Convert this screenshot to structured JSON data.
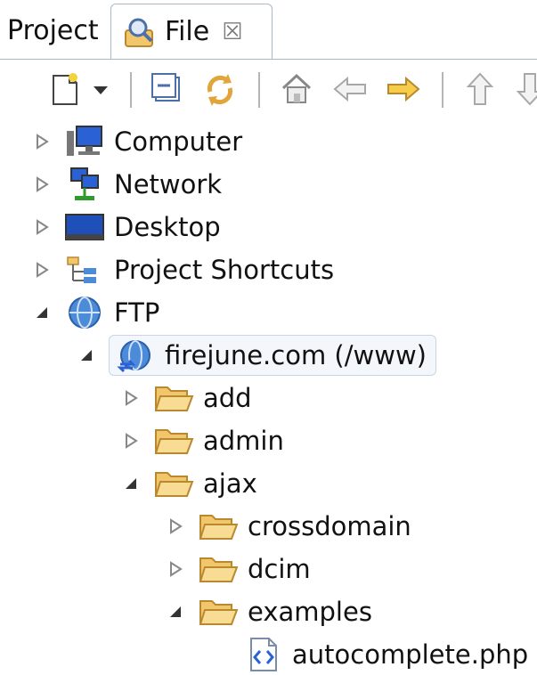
{
  "tabs": [
    {
      "label": "Project"
    },
    {
      "label": "File",
      "close_glyph": "☒"
    }
  ],
  "toolbar": {
    "icons": [
      "new-file-icon",
      "dropdown-arrow-icon",
      "collapse-all-icon",
      "refresh-icon",
      "home-icon",
      "back-arrow-icon",
      "forward-arrow-icon",
      "up-arrow-icon",
      "down-arrow-icon"
    ]
  },
  "tree": {
    "items": [
      {
        "label": "Computer",
        "icon": "computer-icon",
        "expanded": false
      },
      {
        "label": "Network",
        "icon": "network-icon",
        "expanded": false
      },
      {
        "label": "Desktop",
        "icon": "desktop-icon",
        "expanded": false
      },
      {
        "label": "Project Shortcuts",
        "icon": "shortcuts-icon",
        "expanded": false
      },
      {
        "label": "FTP",
        "icon": "globe-icon",
        "expanded": true
      },
      {
        "label": "firejune.com (/www)",
        "icon": "ftp-site-icon",
        "expanded": true,
        "selected": true
      },
      {
        "label": "add",
        "icon": "folder-icon",
        "expanded": false
      },
      {
        "label": "admin",
        "icon": "folder-icon",
        "expanded": false
      },
      {
        "label": "ajax",
        "icon": "folder-icon",
        "expanded": true
      },
      {
        "label": "crossdomain",
        "icon": "folder-icon",
        "expanded": false
      },
      {
        "label": "dcim",
        "icon": "folder-icon",
        "expanded": false
      },
      {
        "label": "examples",
        "icon": "folder-icon",
        "expanded": true
      },
      {
        "label": "autocomplete.php",
        "icon": "php-file-icon"
      }
    ]
  },
  "colors": {
    "selection_border": "#c8d6e8",
    "folder": "#f2c66b",
    "tab_border": "#a9b7c9"
  }
}
